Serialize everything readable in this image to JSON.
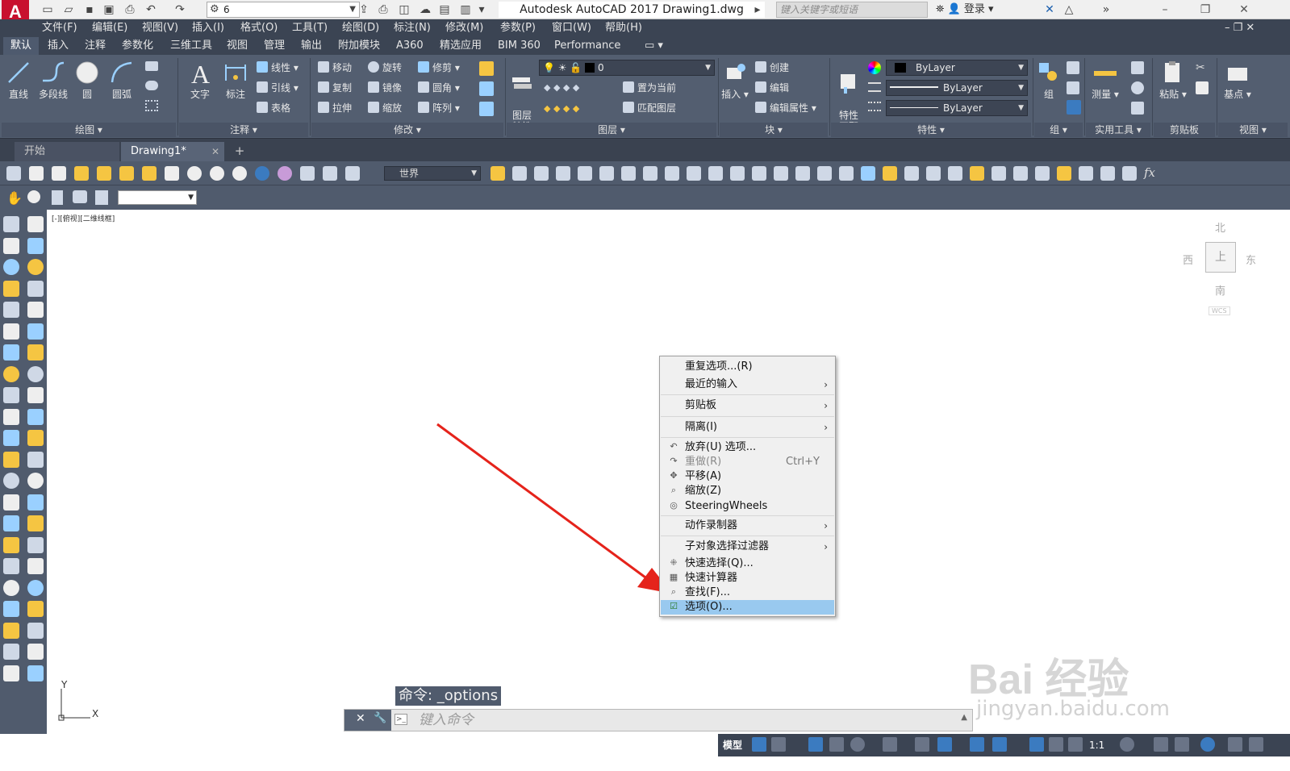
{
  "titlebar": {
    "app_logo": "A",
    "workspace": "6",
    "title": "Autodesk AutoCAD 2017    Drawing1.dwg",
    "search_placeholder": "键入关键字或短语",
    "login": "登录"
  },
  "menubar": [
    "文件(F)",
    "编辑(E)",
    "视图(V)",
    "插入(I)",
    "格式(O)",
    "工具(T)",
    "绘图(D)",
    "标注(N)",
    "修改(M)",
    "参数(P)",
    "窗口(W)",
    "帮助(H)"
  ],
  "ribbon_tabs": [
    "默认",
    "插入",
    "注释",
    "参数化",
    "三维工具",
    "视图",
    "管理",
    "输出",
    "附加模块",
    "A360",
    "精选应用",
    "BIM 360",
    "Performance"
  ],
  "ribbon": {
    "draw": {
      "title": "绘图",
      "line": "直线",
      "polyline": "多段线",
      "circle": "圆",
      "arc": "圆弧"
    },
    "annotation": {
      "title": "注释",
      "text": "文字",
      "dimension": "标注",
      "linear": "线性",
      "leader": "引线",
      "table": "表格"
    },
    "modify": {
      "title": "修改",
      "move": "移动",
      "rotate": "旋转",
      "trim": "修剪",
      "copy": "复制",
      "mirror": "镜像",
      "fillet": "圆角",
      "stretch": "拉伸",
      "scale": "缩放",
      "array": "阵列"
    },
    "layers": {
      "title": "图层",
      "layer_props": "图层\n特性",
      "current_layer": "0",
      "set_current": "置为当前",
      "match_layer": "匹配图层"
    },
    "block": {
      "title": "块",
      "insert": "插入",
      "create": "创建",
      "edit": "编辑",
      "edit_attr": "编辑属性"
    },
    "properties": {
      "title": "特性",
      "match_props": "特性\n匹配",
      "color": "ByLayer",
      "linetype": "ByLayer",
      "lineweight": "ByLayer"
    },
    "groups": {
      "title": "组",
      "group": "组"
    },
    "utilities": {
      "title": "实用工具",
      "measure": "测量"
    },
    "clipboard": {
      "title": "剪贴板",
      "paste": "粘贴"
    },
    "view": {
      "title": "视图",
      "base": "基点"
    }
  },
  "file_tabs": {
    "start": "开始",
    "drawing": "Drawing1*"
  },
  "toolbar": {
    "ucs": "世界"
  },
  "viewport": {
    "label": "[-][俯视][二维线框]"
  },
  "viewcube": {
    "north": "北",
    "south": "南",
    "east": "东",
    "west": "西",
    "wcs": "WCS"
  },
  "ucs_icon": {
    "x": "X",
    "y": "Y"
  },
  "context_menu": {
    "items": [
      {
        "label": "重复选项...(R)"
      },
      {
        "label": "最近的输入",
        "submenu": true
      },
      {
        "label": "剪贴板",
        "submenu": true
      },
      {
        "label": "隔离(I)",
        "submenu": true
      },
      {
        "label": "放弃(U) 选项..."
      },
      {
        "label": "重做(R)",
        "shortcut": "Ctrl+Y",
        "disabled": true
      },
      {
        "label": "平移(A)"
      },
      {
        "label": "缩放(Z)"
      },
      {
        "label": "SteeringWheels"
      },
      {
        "label": "动作录制器",
        "submenu": true
      },
      {
        "label": "子对象选择过滤器",
        "submenu": true
      },
      {
        "label": "快速选择(Q)..."
      },
      {
        "label": "快速计算器"
      },
      {
        "label": "查找(F)..."
      },
      {
        "label": "选项(O)...",
        "highlighted": true
      }
    ]
  },
  "command": {
    "history": "命令:  _options",
    "placeholder": "键入命令"
  },
  "statusbar": {
    "model": "模型",
    "scale": "1:1"
  },
  "watermark": {
    "logo": "Bai 经验",
    "url": "jingyan.baidu.com"
  },
  "colors": {
    "accent": "#99c9ef",
    "arrow": "#e5231b",
    "ribbon": "#535e70"
  }
}
